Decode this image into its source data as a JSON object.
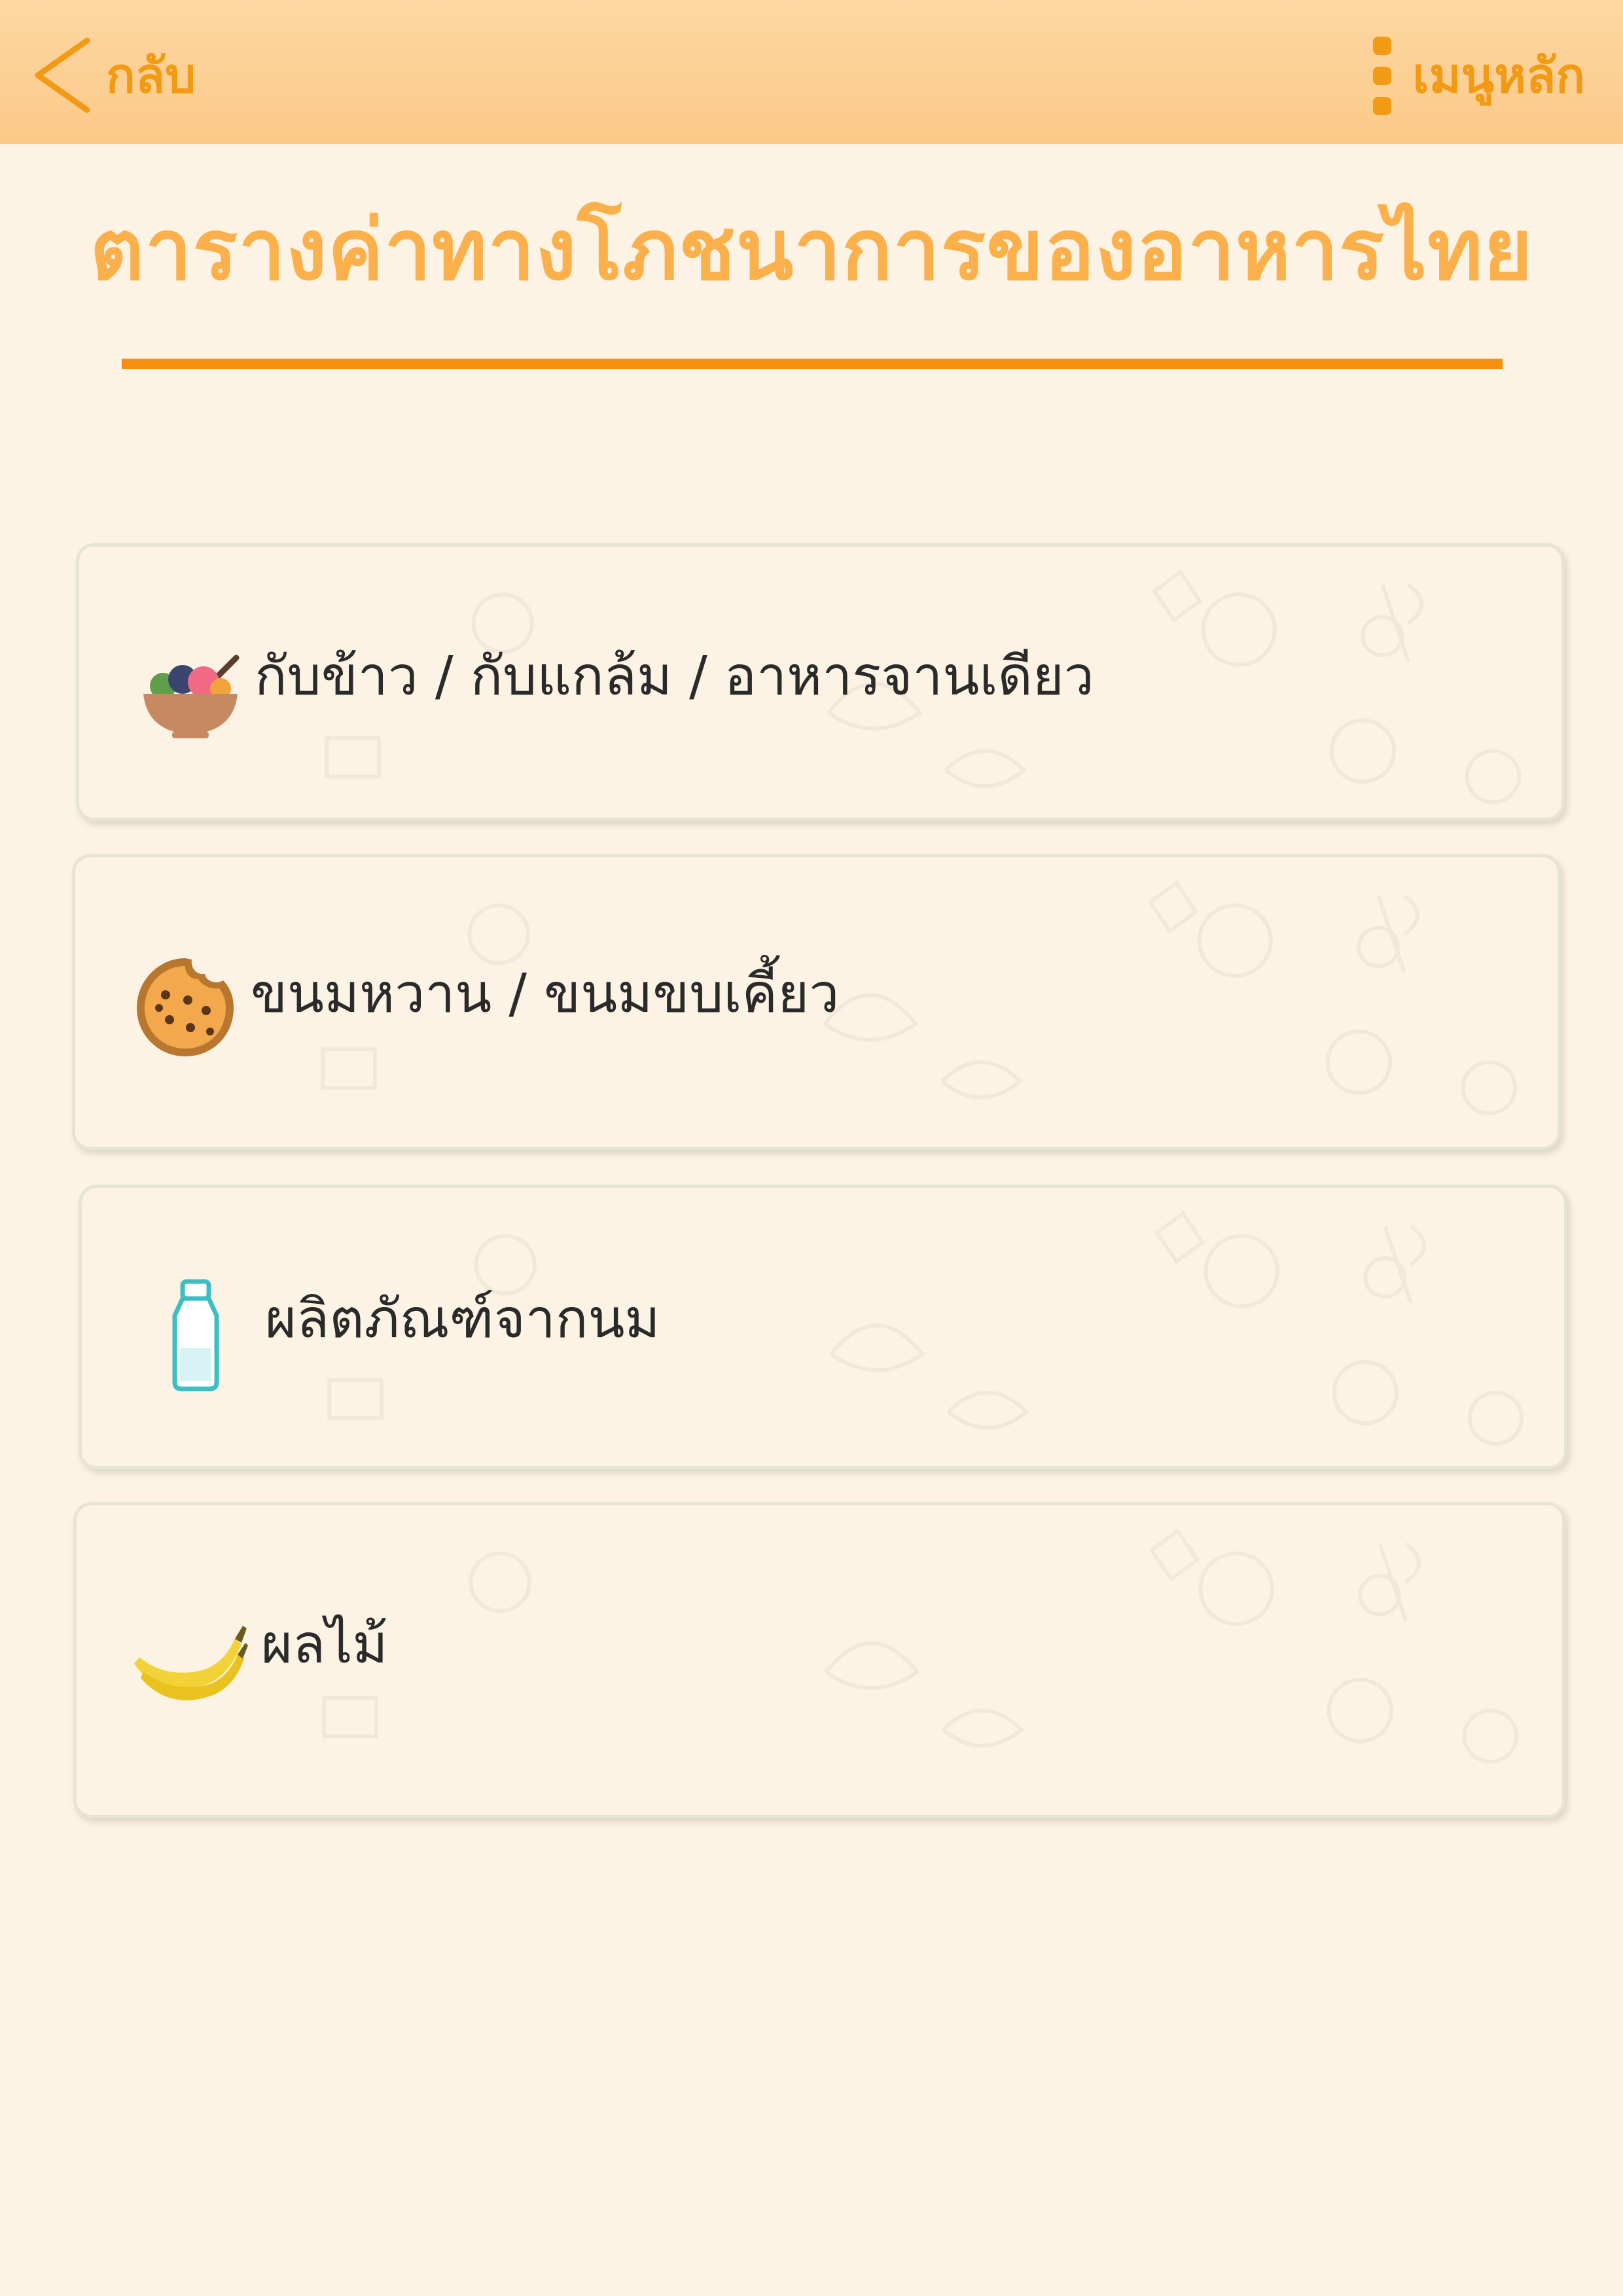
{
  "header": {
    "back_label": "กลับ",
    "menu_label": "เมนูหลัก"
  },
  "page_title": "ตารางค่าทางโภชนาการของอาหารไทย",
  "menu": {
    "items": [
      {
        "label": "กับข้าว / กับแกล้ม / อาหารจานเดียว",
        "icon": "food-bowl-icon"
      },
      {
        "label": "ขนมหวาน / ขนมขบเคี้ยว",
        "icon": "cookie-icon"
      },
      {
        "label": "ผลิตภัณฑ์จากนม",
        "icon": "milk-bottle-icon"
      },
      {
        "label": "ผลไม้",
        "icon": "banana-icon"
      }
    ]
  },
  "colors": {
    "accent": "#f39a14",
    "title": "#fbb04b",
    "header_bg": "#fcd29a",
    "page_bg": "#fdf3e5",
    "card_border": "#e6e5cf"
  }
}
